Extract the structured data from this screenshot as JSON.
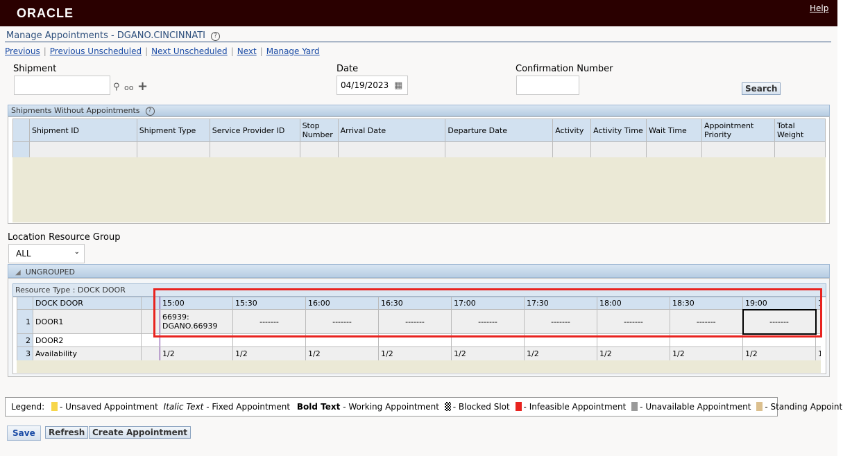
{
  "header": {
    "logo": "ORACLE",
    "help": "Help"
  },
  "title": "Manage Appointments - DGANO.CINCINNATI",
  "nav": [
    "Previous",
    "Previous Unscheduled",
    "Next Unscheduled",
    "Next",
    "Manage Yard"
  ],
  "form": {
    "shipment_label": "Shipment",
    "shipment_value": "",
    "date_label": "Date",
    "date_value": "04/19/2023",
    "confirmation_label": "Confirmation Number",
    "confirmation_value": "",
    "search": "Search"
  },
  "shipments_panel": {
    "title": "Shipments Without Appointments",
    "columns": [
      "Shipment ID",
      "Shipment Type",
      "Service Provider ID",
      "Stop Number",
      "Arrival Date",
      "Departure Date",
      "Activity",
      "Activity Time",
      "Wait Time",
      "Appointment Priority",
      "Total Weight"
    ]
  },
  "resource_group": {
    "label": "Location Resource Group",
    "value": "ALL"
  },
  "group": {
    "title": "UNGROUPED",
    "resource_type": "Resource Type : DOCK DOOR",
    "header": "DOCK DOOR",
    "times": [
      "15:00",
      "15:30",
      "16:00",
      "16:30",
      "17:00",
      "17:30",
      "18:00",
      "18:30",
      "19:00",
      "1"
    ],
    "rows": [
      {
        "num": "1",
        "name": "DOOR1",
        "cells": [
          "66939:\nDGANO.66939",
          "-------",
          "-------",
          "-------",
          "-------",
          "-------",
          "-------",
          "-------",
          "-------",
          ""
        ]
      },
      {
        "num": "2",
        "name": "DOOR2",
        "cells": [
          "",
          "",
          "",
          "",
          "",
          "",
          "",
          "",
          "",
          ""
        ]
      },
      {
        "num": "3",
        "name": "Availability",
        "cells": [
          "1/2",
          "1/2",
          "1/2",
          "1/2",
          "1/2",
          "1/2",
          "1/2",
          "1/2",
          "1/2",
          "1"
        ]
      }
    ]
  },
  "legend": {
    "label": "Legend:",
    "items": [
      {
        "text": "- Unsaved Appointment",
        "color": "#f7d64a"
      },
      {
        "text": "Italic Text",
        "suffix": " - Fixed Appointment"
      },
      {
        "text": "Bold Text",
        "suffix": " - Working Appointment"
      },
      {
        "text": "- Blocked Slot",
        "color": "checker"
      },
      {
        "text": "- Infeasible Appointment",
        "color": "#e8231f"
      },
      {
        "text": "- Unavailable Appointment",
        "color": "#9a9a9a"
      },
      {
        "text": "- Standing Appointment",
        "color": "#dcc08f"
      }
    ]
  },
  "buttons": {
    "save": "Save",
    "refresh": "Refresh",
    "create": "Create Appointment"
  },
  "colors": {
    "header_bg": "#2a0000",
    "highlight": "#e8231f",
    "link": "#1a4ba5"
  }
}
